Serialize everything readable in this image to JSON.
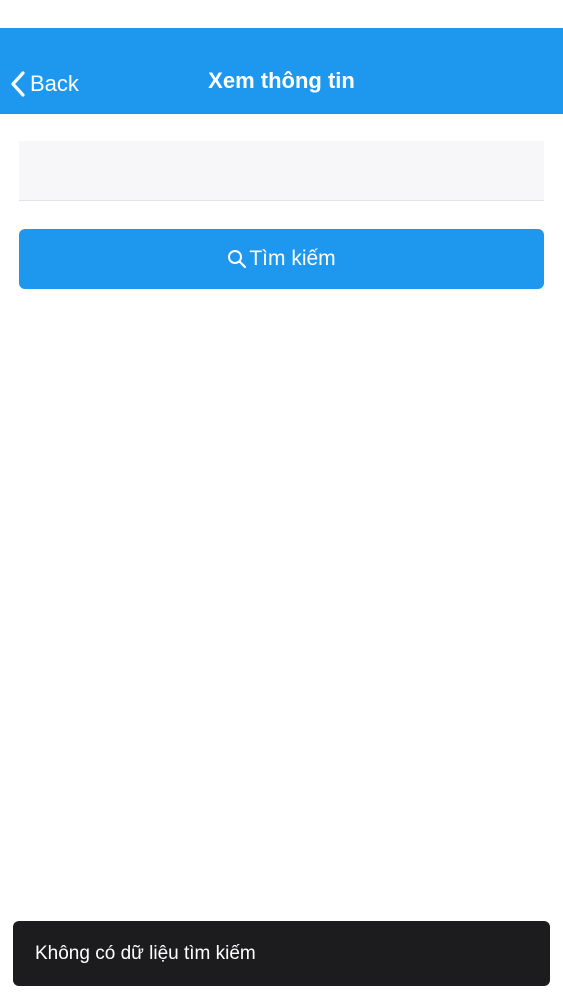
{
  "nav": {
    "back_label": "Back",
    "title": "Xem thông tin"
  },
  "search": {
    "value": "",
    "placeholder": "",
    "button_label": "Tìm kiếm",
    "button_icon": "search-icon"
  },
  "toast": {
    "message": "Không có dữ liệu tìm kiếm"
  },
  "colors": {
    "primary": "#1e98ee",
    "toast_bg": "#1c1c1e",
    "input_bg": "#f7f7f9"
  }
}
